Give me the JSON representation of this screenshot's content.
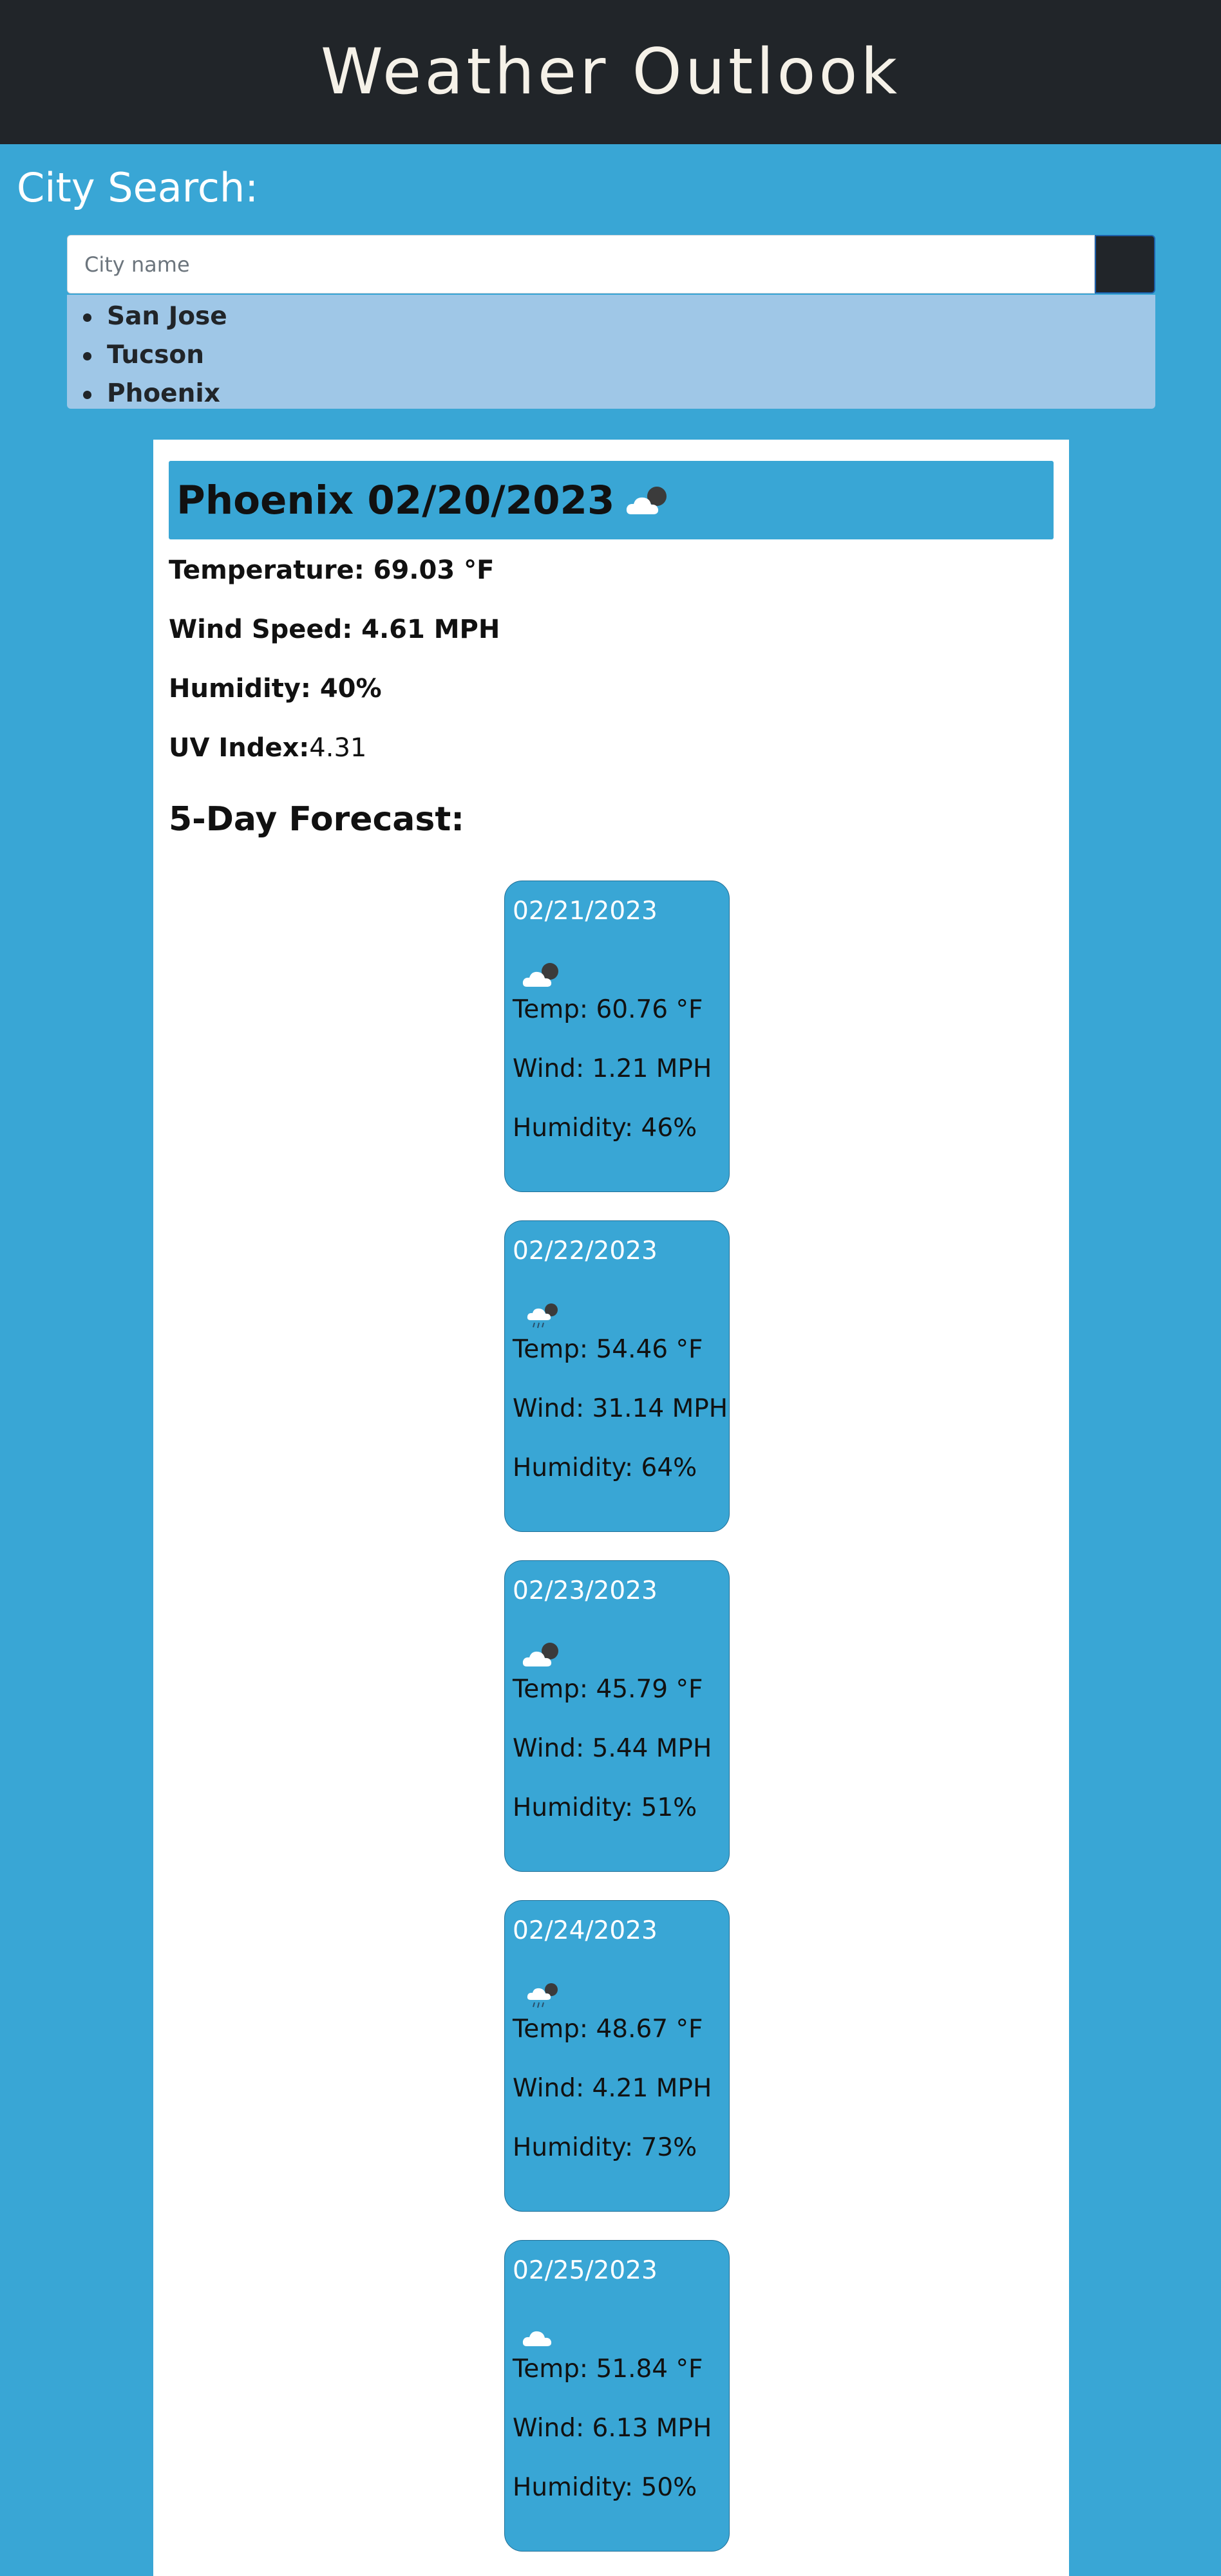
{
  "header": {
    "title": "Weather Outlook"
  },
  "search": {
    "label": "City Search:",
    "placeholder": "City name",
    "value": ""
  },
  "history": [
    {
      "label": "San Jose"
    },
    {
      "label": "Tucson"
    },
    {
      "label": "Phoenix"
    }
  ],
  "current": {
    "title": "Phoenix 02/20/2023",
    "icon": "partly-cloudy-night-icon",
    "temperature": {
      "label": "Temperature: ",
      "value": "69.03 °F"
    },
    "wind": {
      "label": "Wind Speed: ",
      "value": "4.61 MPH"
    },
    "humidity": {
      "label": "Humidity: ",
      "value": "40%"
    },
    "uv": {
      "label": "UV Index:",
      "value": "4.31"
    }
  },
  "forecast": {
    "heading": "5-Day Forecast:",
    "days": [
      {
        "date": "02/21/2023",
        "icon": "partly-cloudy-night-icon",
        "temp": "Temp: 60.76 °F",
        "wind": "Wind: 1.21 MPH",
        "humidity": "Humidity: 46%"
      },
      {
        "date": "02/22/2023",
        "icon": "rain-night-icon",
        "temp": "Temp: 54.46 °F",
        "wind": "Wind: 31.14 MPH",
        "humidity": "Humidity: 64%"
      },
      {
        "date": "02/23/2023",
        "icon": "partly-cloudy-night-icon",
        "temp": "Temp: 45.79 °F",
        "wind": "Wind: 5.44 MPH",
        "humidity": "Humidity: 51%"
      },
      {
        "date": "02/24/2023",
        "icon": "rain-night-icon",
        "temp": "Temp: 48.67 °F",
        "wind": "Wind: 4.21 MPH",
        "humidity": "Humidity: 73%"
      },
      {
        "date": "02/25/2023",
        "icon": "cloud-icon",
        "temp": "Temp: 51.84 °F",
        "wind": "Wind: 6.13 MPH",
        "humidity": "Humidity: 50%"
      }
    ]
  },
  "colors": {
    "page_background": "#39a6d5",
    "header_background": "#212529",
    "history_background": "#9fc7e7",
    "card_background": "#ffffff"
  }
}
